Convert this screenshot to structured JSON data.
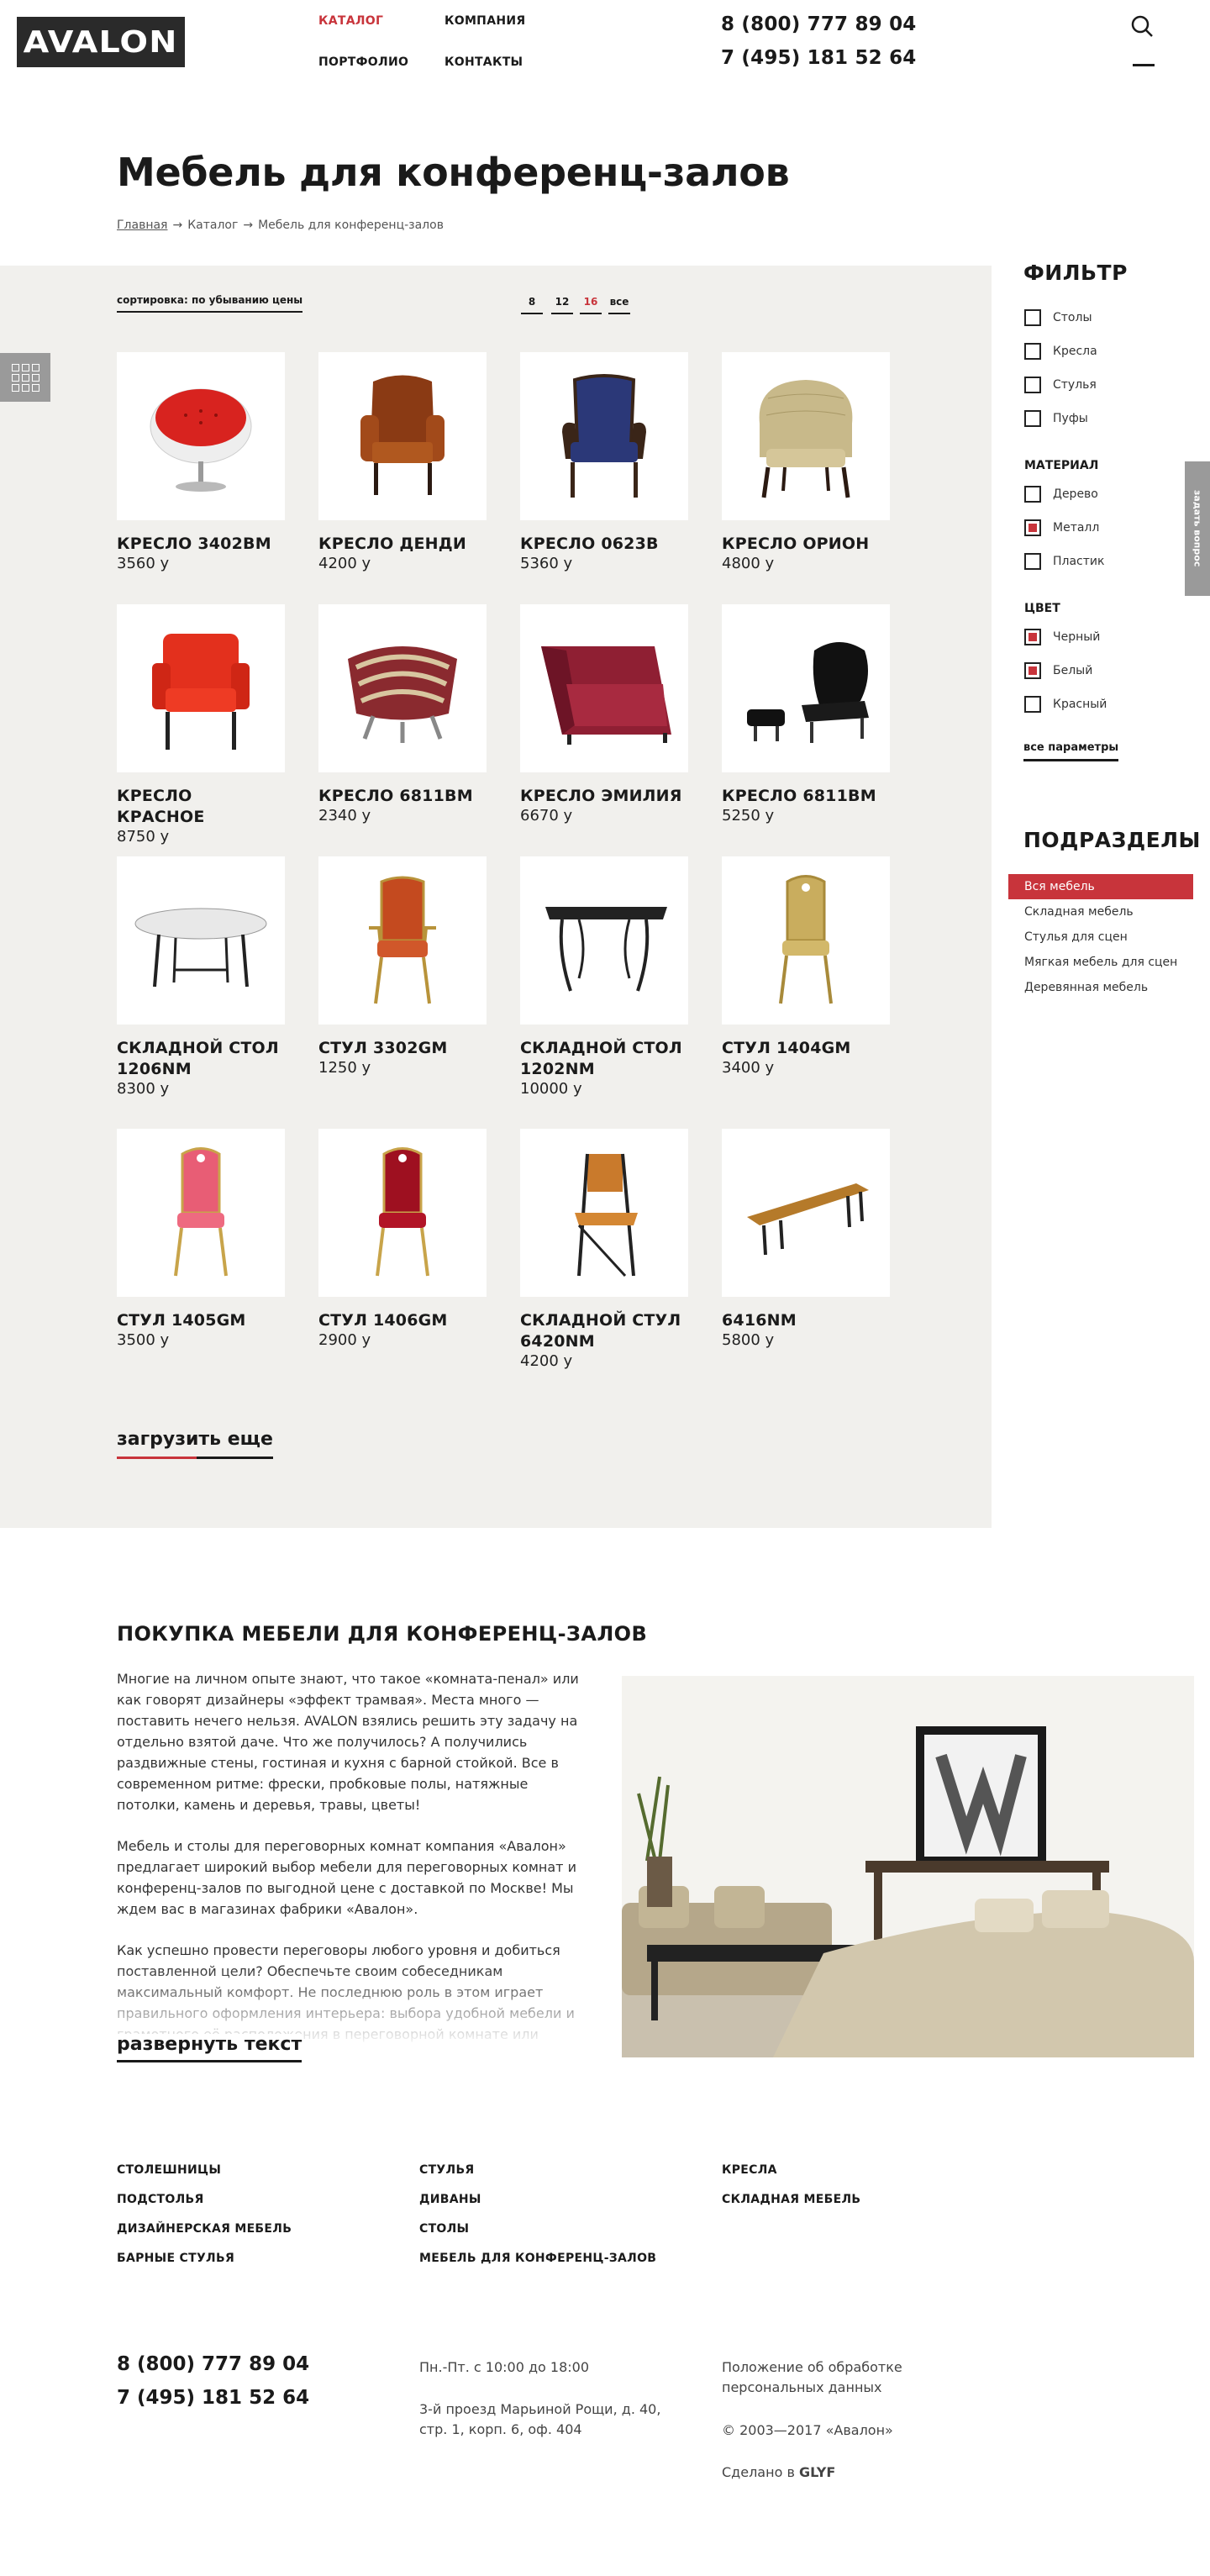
{
  "header": {
    "logo": "AVALON",
    "nav": [
      "КАТАЛОГ",
      "КОМПАНИЯ",
      "ПОРТФОЛИО",
      "КОНТАКТЫ"
    ],
    "phones": [
      "8 (800) 777 89 04",
      "7 (495) 181 52 64"
    ]
  },
  "page": {
    "title": "Мебель для конференц-залов",
    "breadcrumb": [
      "Главная",
      "Каталог",
      "Мебель для конференц-залов"
    ]
  },
  "toolbar": {
    "sort_label": "сортировка: по убыванию цены",
    "per_page": [
      "8",
      "12",
      "16",
      "все"
    ],
    "per_page_active": "16"
  },
  "products": [
    {
      "name": "КРЕСЛО 3402BM",
      "price": "3560 у"
    },
    {
      "name": "КРЕСЛО ДЕНДИ",
      "price": "4200 у"
    },
    {
      "name": "КРЕСЛО 0623B",
      "price": "5360 у"
    },
    {
      "name": "КРЕСЛО ОРИОН",
      "price": "4800 у"
    },
    {
      "name": "КРЕСЛО КРАСНОЕ",
      "price": "8750 у"
    },
    {
      "name": "КРЕСЛО 6811BM",
      "price": "2340 у"
    },
    {
      "name": "КРЕСЛО ЭМИЛИЯ",
      "price": "6670 у"
    },
    {
      "name": "КРЕСЛО 6811BM",
      "price": "5250 у"
    },
    {
      "name": "СКЛАДНОЙ СТОЛ 1206NM",
      "price": "8300 у"
    },
    {
      "name": "СТУЛ 3302GM",
      "price": "1250 у"
    },
    {
      "name": "СКЛАДНОЙ СТОЛ 1202NM",
      "price": "10000 у"
    },
    {
      "name": "СТУЛ 1404GM",
      "price": "3400 у"
    },
    {
      "name": "СТУЛ 1405GM",
      "price": "3500 у"
    },
    {
      "name": "СТУЛ 1406GM",
      "price": "2900 у"
    },
    {
      "name": "СКЛАДНОЙ СТУЛ 6420NM",
      "price": "4200 у"
    },
    {
      "name": "6416NM",
      "price": "5800 у"
    }
  ],
  "load_more": "загрузить еще",
  "filter": {
    "title": "ФИЛЬТР",
    "types": [
      {
        "label": "Столы",
        "checked": false
      },
      {
        "label": "Кресла",
        "checked": false
      },
      {
        "label": "Стулья",
        "checked": false
      },
      {
        "label": "Пуфы",
        "checked": false
      }
    ],
    "material_title": "МАТЕРИАЛ",
    "materials": [
      {
        "label": "Дерево",
        "checked": false
      },
      {
        "label": "Металл",
        "checked": true
      },
      {
        "label": "Пластик",
        "checked": false
      }
    ],
    "color_title": "ЦВЕТ",
    "colors": [
      {
        "label": "Черный",
        "checked": true
      },
      {
        "label": "Белый",
        "checked": true
      },
      {
        "label": "Красный",
        "checked": false
      }
    ],
    "all_params": "все параметры"
  },
  "subsections": {
    "title": "ПОДРАЗДЕЛЫ",
    "items": [
      "Вся мебель",
      "Складная мебель",
      "Стулья для сцен",
      "Мягкая мебель для сцен",
      "Деревянная мебель"
    ],
    "active": "Вся мебель"
  },
  "ask_tab": "задать вопрос",
  "article": {
    "title": "ПОКУПКА МЕБЕЛИ ДЛЯ КОНФЕРЕНЦ-ЗАЛОВ",
    "paragraphs": [
      "Многие на личном опыте знают, что такое «комната-пенал» или как говорят дизайнеры «эффект трамвая». Места много — поставить нечего нельзя. AVALON взялись решить эту задачу на отдельно взятой даче. Что же получилось? А получились раздвижные стены, гостиная и кухня с барной стойкой. Все в современном ритме: фрески, пробковые полы, натяжные потолки, камень и деревья, травы, цветы!",
      "Мебель и столы для переговорных комнат компания «Авалон» предлагает широкий выбор мебели для переговорных комнат и конференц-залов по выгодной цене с доставкой по Москве! Мы ждем вас в магазинах фабрики «Авалон».",
      "Как успешно провести переговоры любого уровня и добиться поставленной цели? Обеспечьте своим собеседникам максимальный комфорт. Не последнюю роль в этом играет правильного оформления интерьера: выбора удобной мебели и грамотного её расположения в переговорной комнате или конференц-зале."
    ],
    "expand": "развернуть текст"
  },
  "footer": {
    "links": [
      [
        "СТОЛЕШНИЦЫ",
        "ПОДСТОЛЬЯ",
        "ДИЗАЙНЕРСКАЯ МЕБЕЛЬ",
        "БАРНЫЕ СТУЛЬЯ"
      ],
      [
        "СТУЛЬЯ",
        "ДИВАНЫ",
        "СТОЛЫ",
        "МЕБЕЛЬ ДЛЯ КОНФЕРЕНЦ-ЗАЛОВ"
      ],
      [
        "КРЕСЛА",
        "СКЛАДНАЯ МЕБЕЛЬ"
      ]
    ],
    "phones": [
      "8 (800) 777 89 04",
      "7 (495) 181 52 64"
    ],
    "hours": "Пн.-Пт. с 10:00 до 18:00",
    "address": "3-й проезд Марьиной Рощи, д. 40, стр. 1, корп. 6, оф. 404",
    "privacy": "Положение об обработке персональных данных",
    "copyright": "© 2003—2017 «Авалон»",
    "made_by_prefix": "Сделано в",
    "made_by": "GLYF"
  }
}
